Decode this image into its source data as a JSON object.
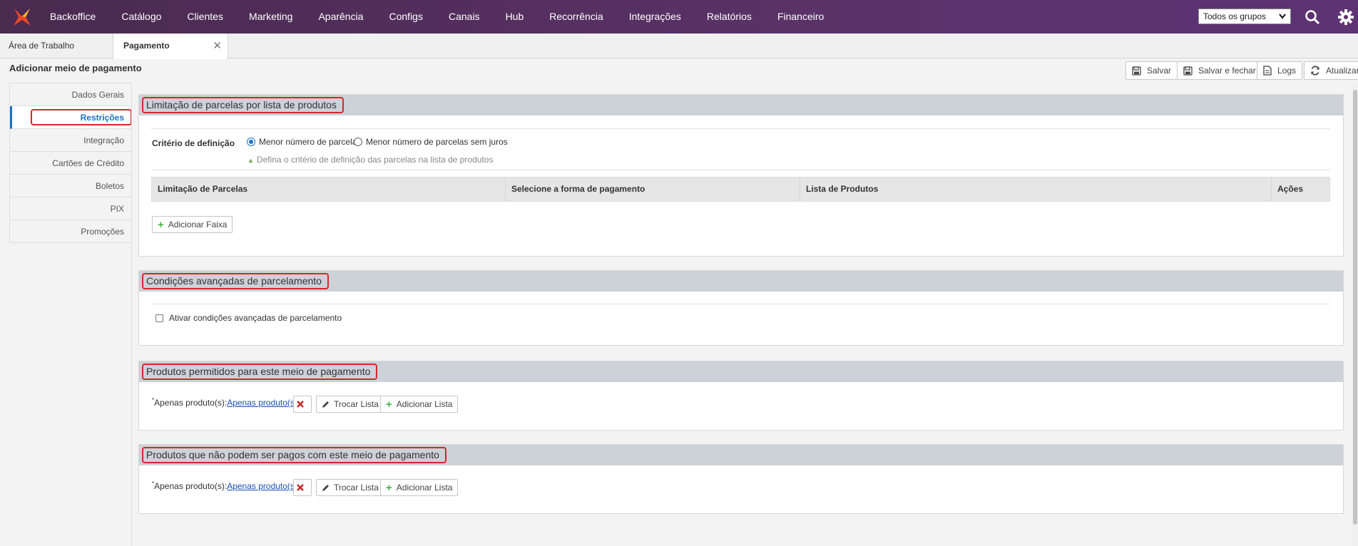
{
  "nav": {
    "items": [
      "Backoffice",
      "Catálogo",
      "Clientes",
      "Marketing",
      "Aparência",
      "Configs",
      "Canais",
      "Hub",
      "Recorrência",
      "Integrações",
      "Relatórios",
      "Financeiro"
    ],
    "group_select": "Todos os grupos"
  },
  "tabs": {
    "home": "Área de Trabalho",
    "active": "Pagamento"
  },
  "page": {
    "title": "Adicionar meio de pagamento"
  },
  "toolbar": {
    "save": "Salvar",
    "save_close": "Salvar e fechar",
    "logs": "Logs",
    "refresh": "Atualizar"
  },
  "sidebar": {
    "items": [
      "Dados Gerais",
      "Restrições",
      "Integração",
      "Cartões de Crédito",
      "Boletos",
      "PIX",
      "Promoções"
    ],
    "active": "Restrições"
  },
  "panel1": {
    "title": "Limitação de parcelas por lista de produtos",
    "criteria_label": "Critério de definição",
    "option1": "Menor número de parcelas",
    "option2": "Menor número de parcelas sem juros",
    "hint": "Defina o critério de definição das parcelas na lista de produtos",
    "columns": [
      "Limitação de Parcelas",
      "Selecione a forma de pagamento",
      "Lista de Produtos",
      "Ações"
    ],
    "add_button": "Adicionar Faixa"
  },
  "panel2": {
    "title": "Condições avançadas de parcelamento",
    "checkbox_label": "Ativar condições avançadas de parcelamento"
  },
  "panel3": {
    "title": "Produtos permitidos para este meio de pagamento",
    "label_prefix": "Apenas produto(s):",
    "link": "Apenas produto(s):",
    "swap_button": "Trocar Lista",
    "add_button": "Adicionar Lista"
  },
  "panel4": {
    "title": "Produtos que não podem ser pagos com este meio de pagamento",
    "label_prefix": "Apenas produto(s):",
    "link": "Apenas produto(s):",
    "swap_button": "Trocar Lista",
    "add_button": "Adicionar Lista"
  }
}
